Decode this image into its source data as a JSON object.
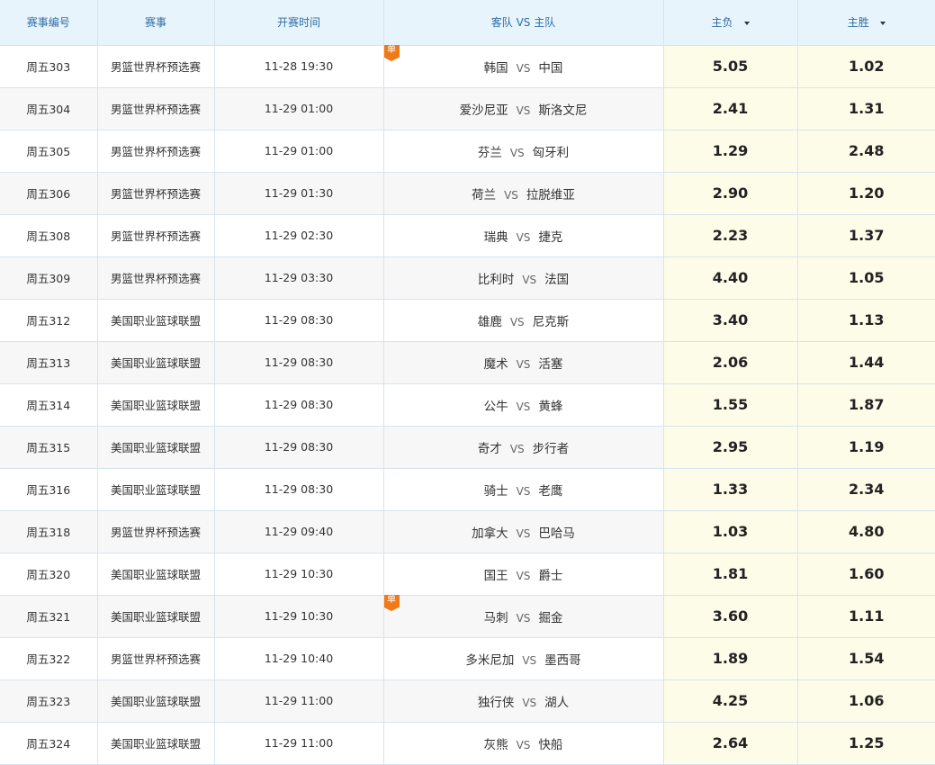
{
  "header": {
    "match_no": "赛事编号",
    "league": "赛事",
    "time": "开赛时间",
    "teams": "客队 VS 主队",
    "away_win": "主负",
    "home_win": "主胜"
  },
  "vs_label": "VS",
  "single_label": "单",
  "rows": [
    {
      "no": "周五303",
      "league": "男篮世界杯预选赛",
      "time": "11-28 19:30",
      "away": "韩国",
      "home": "中国",
      "lose": "5.05",
      "win": "1.02",
      "single": true
    },
    {
      "no": "周五304",
      "league": "男篮世界杯预选赛",
      "time": "11-29 01:00",
      "away": "爱沙尼亚",
      "home": "斯洛文尼",
      "lose": "2.41",
      "win": "1.31",
      "single": false
    },
    {
      "no": "周五305",
      "league": "男篮世界杯预选赛",
      "time": "11-29 01:00",
      "away": "芬兰",
      "home": "匈牙利",
      "lose": "1.29",
      "win": "2.48",
      "single": false
    },
    {
      "no": "周五306",
      "league": "男篮世界杯预选赛",
      "time": "11-29 01:30",
      "away": "荷兰",
      "home": "拉脱维亚",
      "lose": "2.90",
      "win": "1.20",
      "single": false
    },
    {
      "no": "周五308",
      "league": "男篮世界杯预选赛",
      "time": "11-29 02:30",
      "away": "瑞典",
      "home": "捷克",
      "lose": "2.23",
      "win": "1.37",
      "single": false
    },
    {
      "no": "周五309",
      "league": "男篮世界杯预选赛",
      "time": "11-29 03:30",
      "away": "比利时",
      "home": "法国",
      "lose": "4.40",
      "win": "1.05",
      "single": false
    },
    {
      "no": "周五312",
      "league": "美国职业篮球联盟",
      "time": "11-29 08:30",
      "away": "雄鹿",
      "home": "尼克斯",
      "lose": "3.40",
      "win": "1.13",
      "single": false
    },
    {
      "no": "周五313",
      "league": "美国职业篮球联盟",
      "time": "11-29 08:30",
      "away": "魔术",
      "home": "活塞",
      "lose": "2.06",
      "win": "1.44",
      "single": false
    },
    {
      "no": "周五314",
      "league": "美国职业篮球联盟",
      "time": "11-29 08:30",
      "away": "公牛",
      "home": "黄蜂",
      "lose": "1.55",
      "win": "1.87",
      "single": false
    },
    {
      "no": "周五315",
      "league": "美国职业篮球联盟",
      "time": "11-29 08:30",
      "away": "奇才",
      "home": "步行者",
      "lose": "2.95",
      "win": "1.19",
      "single": false
    },
    {
      "no": "周五316",
      "league": "美国职业篮球联盟",
      "time": "11-29 08:30",
      "away": "骑士",
      "home": "老鹰",
      "lose": "1.33",
      "win": "2.34",
      "single": false
    },
    {
      "no": "周五318",
      "league": "男篮世界杯预选赛",
      "time": "11-29 09:40",
      "away": "加拿大",
      "home": "巴哈马",
      "lose": "1.03",
      "win": "4.80",
      "single": false
    },
    {
      "no": "周五320",
      "league": "美国职业篮球联盟",
      "time": "11-29 10:30",
      "away": "国王",
      "home": "爵士",
      "lose": "1.81",
      "win": "1.60",
      "single": false
    },
    {
      "no": "周五321",
      "league": "美国职业篮球联盟",
      "time": "11-29 10:30",
      "away": "马刺",
      "home": "掘金",
      "lose": "3.60",
      "win": "1.11",
      "single": true
    },
    {
      "no": "周五322",
      "league": "男篮世界杯预选赛",
      "time": "11-29 10:40",
      "away": "多米尼加",
      "home": "墨西哥",
      "lose": "1.89",
      "win": "1.54",
      "single": false
    },
    {
      "no": "周五323",
      "league": "美国职业篮球联盟",
      "time": "11-29 11:00",
      "away": "独行侠",
      "home": "湖人",
      "lose": "4.25",
      "win": "1.06",
      "single": false
    },
    {
      "no": "周五324",
      "league": "美国职业篮球联盟",
      "time": "11-29 11:00",
      "away": "灰熊",
      "home": "快船",
      "lose": "2.64",
      "win": "1.25",
      "single": false
    }
  ]
}
